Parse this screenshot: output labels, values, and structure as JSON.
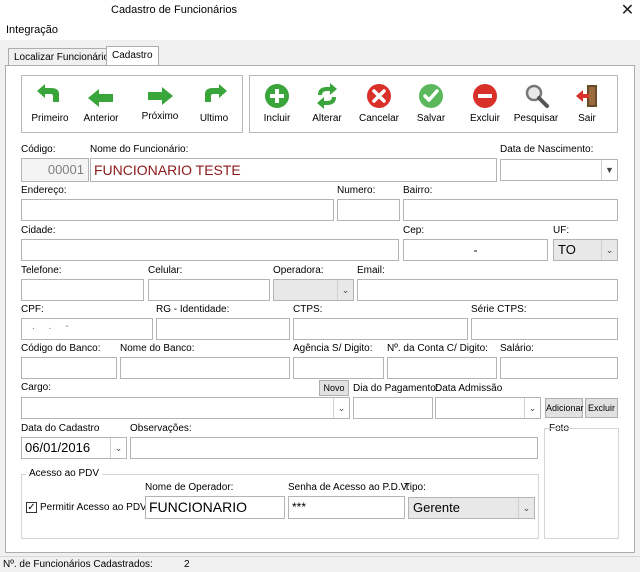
{
  "window": {
    "title": "Cadastro de Funcionários"
  },
  "menu": {
    "integracao": "Integração"
  },
  "tabs": {
    "localizar": "Localizar Funcionário",
    "cadastro": "Cadastro"
  },
  "nav": {
    "primeiro": "Primeiro",
    "anterior": "Anterior",
    "proximo": "Próximo",
    "ultimo": "Ultimo"
  },
  "actions": {
    "incluir": "Incluir",
    "alterar": "Alterar",
    "cancelar": "Cancelar",
    "salvar": "Salvar",
    "excluir": "Excluir",
    "pesquisar": "Pesquisar",
    "sair": "Sair"
  },
  "form": {
    "codigo_label": "Código:",
    "codigo_value": "00001",
    "nome_label": "Nome do Funcionário:",
    "nome_value": "FUNCIONARIO TESTE",
    "nascimento_label": "Data de Nascimento:",
    "endereco_label": "Endereço:",
    "numero_label": "Numero:",
    "bairro_label": "Bairro:",
    "cidade_label": "Cidade:",
    "cep_label": "Cep:",
    "cep_value": "-",
    "uf_label": "UF:",
    "uf_value": "TO",
    "telefone_label": "Telefone:",
    "celular_label": "Celular:",
    "operadora_label": "Operadora:",
    "email_label": "Email:",
    "cpf_label": "CPF:",
    "cpf_value": ".     .     -",
    "rg_label": "RG - Identidade:",
    "ctps_label": "CTPS:",
    "serie_label": "Série CTPS:",
    "cod_banco_label": "Código do Banco:",
    "nome_banco_label": "Nome do Banco:",
    "agencia_label": "Agência S/ Digito:",
    "conta_label": "Nº. da Conta C/ Digito:",
    "salario_label": "Salário:",
    "cargo_label": "Cargo:",
    "novo_label": "Novo",
    "dia_pag_label": "Dia do Pagamento:",
    "data_adm_label": "Data Admissão",
    "adicionar_label": "Adicionar",
    "excluir_small_label": "Excluir",
    "data_cadastro_label": "Data do Cadastro",
    "data_cadastro_value": "06/01/2016",
    "obs_label": "Observações:",
    "foto_label": "Foto"
  },
  "pdv": {
    "group_label": "Acesso ao PDV",
    "permitir_label": "Permitir Acesso ao PDV",
    "operador_label": "Nome de Operador:",
    "operador_value": "FUNCIONARIO",
    "senha_label": "Senha de Acesso ao P.D.V:",
    "senha_value": "***",
    "tipo_label": "Tipo:",
    "tipo_value": "Gerente"
  },
  "status": {
    "label": "Nº. de Funcionários Cadastrados:",
    "count": "2"
  },
  "icons": {
    "nav": "arrow-icons",
    "incluir": "plus-icon",
    "alterar": "refresh-icon",
    "cancelar": "x-circle-icon",
    "salvar": "check-icon",
    "excluir": "minus-icon",
    "pesquisar": "magnifier-icon",
    "sair": "exit-door-icon"
  },
  "colors": {
    "green": "#3aa53a",
    "red": "#d9302a",
    "name_text": "#8b1a1a",
    "gray_code": "#808080"
  }
}
